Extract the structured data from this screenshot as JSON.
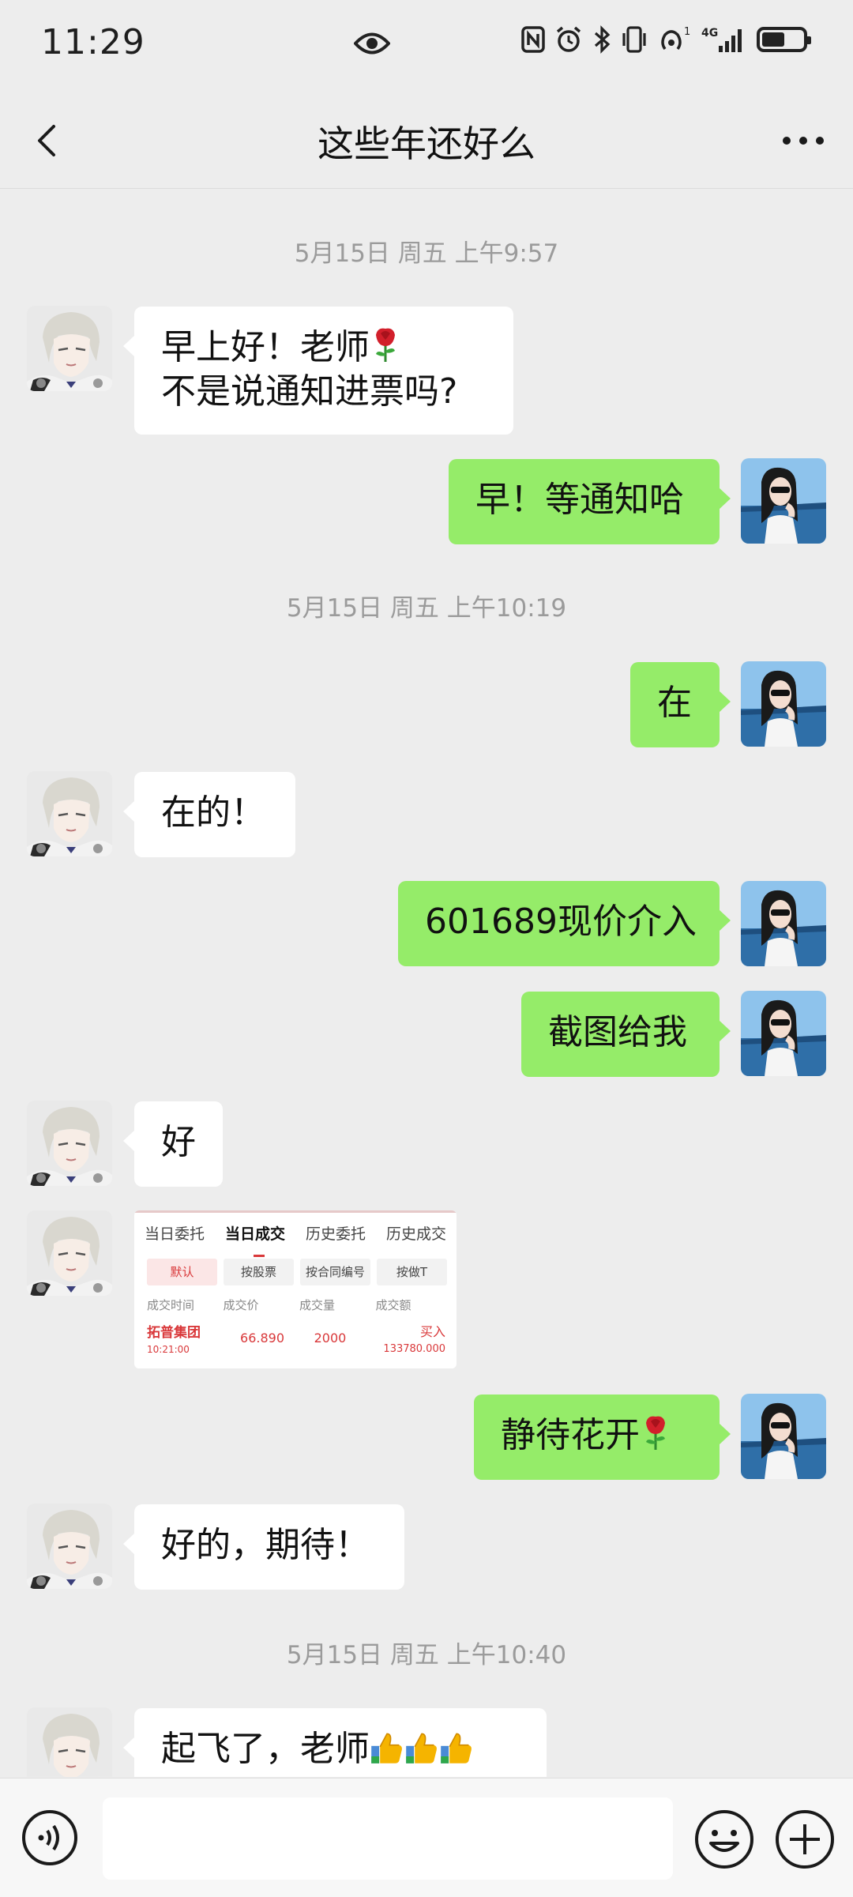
{
  "status_bar": {
    "time": "11:29",
    "icons": [
      "eye-icon",
      "nfc-icon",
      "alarm-icon",
      "bluetooth-icon",
      "vibrate-icon",
      "hotspot-icon",
      "signal-4g-icon",
      "battery-icon"
    ],
    "network": "4G",
    "hotspot_count": "1"
  },
  "nav": {
    "title": "这些年还好么",
    "back_icon": "chevron-left-icon",
    "more_icon": "more-dots-icon"
  },
  "timestamps": {
    "t1": "5月15日 周五 上午9:57",
    "t2": "5月15日 周五 上午10:19",
    "t3": "5月15日 周五 上午10:40"
  },
  "messages": {
    "m1_line1": "早上好！老师",
    "m1_line2": "不是说通知进票吗?",
    "m2": "早！等通知哈",
    "m3": "在",
    "m4": "在的！",
    "m5": "601689现价介入",
    "m6": "截图给我",
    "m7": "好",
    "m9": "静待花开",
    "m10": "好的，期待！",
    "m11": "起飞了，老师"
  },
  "screenshot": {
    "tabs": [
      "当日委托",
      "当日成交",
      "历史委托",
      "历史成交"
    ],
    "active_tab": "当日成交",
    "filters": [
      "默认",
      "按股票",
      "按合同编号",
      "按做T"
    ],
    "headers": [
      "成交时间",
      "成交价",
      "成交量",
      "成交额"
    ],
    "row": {
      "name": "拓普集团",
      "time": "10:21:00",
      "price": "66.890",
      "qty": "2000",
      "side": "买入",
      "amount": "133780.000"
    }
  },
  "input": {
    "placeholder": "",
    "voice_icon": "voice-icon",
    "emoji_icon": "emoji-icon",
    "plus_icon": "plus-icon"
  },
  "colors": {
    "background": "#ededed",
    "outgoing_bubble": "#95ec69",
    "incoming_bubble": "#ffffff",
    "trade_red": "#d9383a"
  }
}
